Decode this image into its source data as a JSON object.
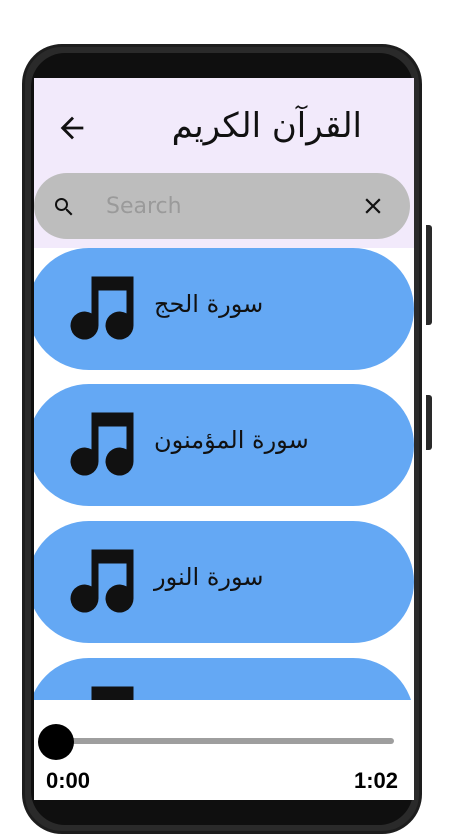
{
  "app": {
    "title": "القرآن الكريم"
  },
  "search": {
    "placeholder": "Search",
    "value": ""
  },
  "surahs": [
    {
      "label": "سورة الحج",
      "icon": "music-note-icon"
    },
    {
      "label": "سورة المؤمنون",
      "icon": "music-note-icon"
    },
    {
      "label": "سورة النور",
      "icon": "music-note-icon"
    },
    {
      "label": "",
      "icon": "music-note-icon"
    }
  ],
  "player": {
    "current_time": "0:00",
    "duration": "1:02",
    "progress": 0
  },
  "colors": {
    "appbar_bg": "#f2eafb",
    "item_bg": "#64a8f4",
    "search_bg": "#bdbdbd"
  }
}
